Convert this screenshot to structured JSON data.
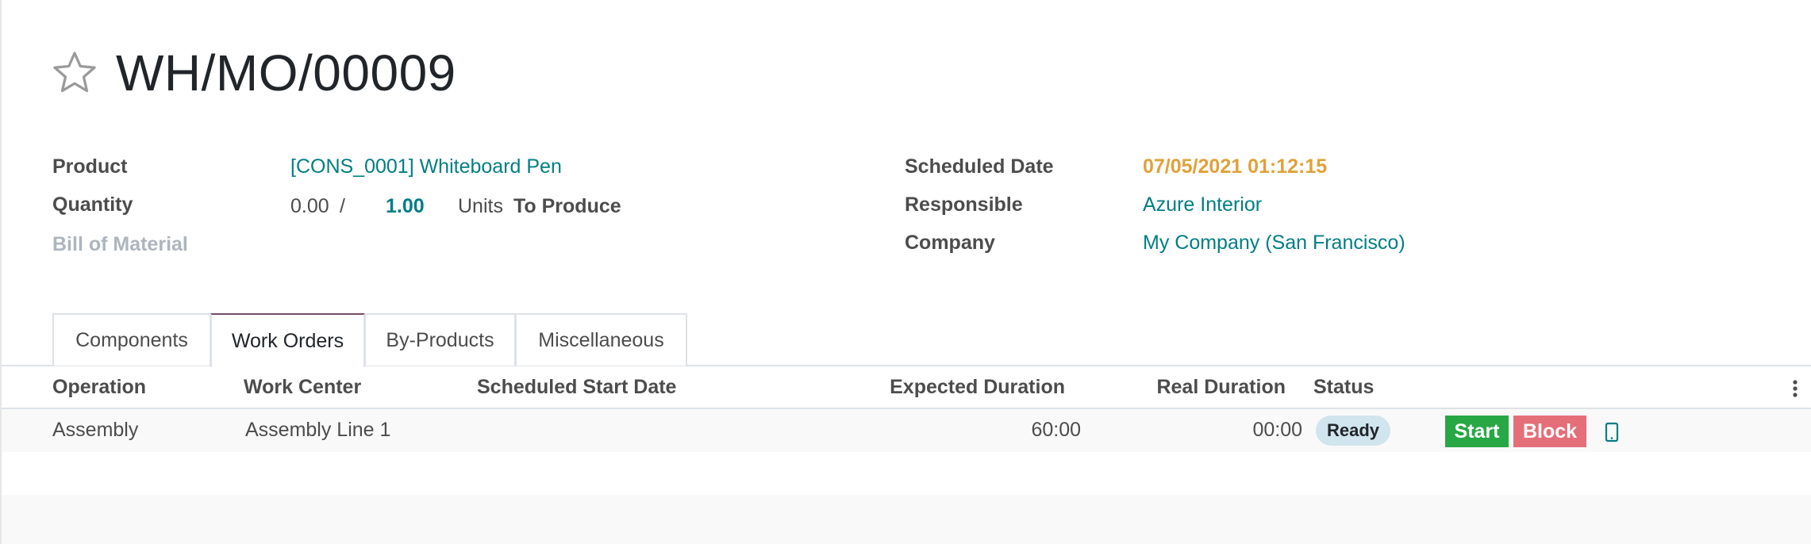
{
  "record": {
    "title": "WH/MO/00009"
  },
  "fields": {
    "product_label": "Product",
    "product_value": "[CONS_0001] Whiteboard Pen",
    "quantity_label": "Quantity",
    "quantity_produced": "0.00",
    "quantity_separator": "/",
    "quantity_to_produce": "1.00",
    "quantity_uom": "Units",
    "quantity_suffix": "To Produce",
    "bom_label": "Bill of Material",
    "scheduled_date_label": "Scheduled Date",
    "scheduled_date_value": "07/05/2021 01:12:15",
    "responsible_label": "Responsible",
    "responsible_value": "Azure Interior",
    "company_label": "Company",
    "company_value": "My Company (San Francisco)"
  },
  "tabs": [
    {
      "label": "Components"
    },
    {
      "label": "Work Orders"
    },
    {
      "label": "By-Products"
    },
    {
      "label": "Miscellaneous"
    }
  ],
  "table": {
    "headers": {
      "operation": "Operation",
      "work_center": "Work Center",
      "scheduled_start": "Scheduled Start Date",
      "expected_duration": "Expected Duration",
      "real_duration": "Real Duration",
      "status": "Status"
    },
    "rows": [
      {
        "operation": "Assembly",
        "work_center": "Assembly Line 1",
        "scheduled_start": "",
        "expected_duration": "60:00",
        "real_duration": "00:00",
        "status": "Ready",
        "start_label": "Start",
        "block_label": "Block"
      }
    ]
  },
  "icons": {
    "favorite": "star-outline-icon",
    "tablet": "tablet-icon",
    "options": "kebab-menu-icon"
  },
  "colors": {
    "link": "#017e84",
    "date_warning": "#e0a13b",
    "active_tab": "#714b67",
    "start_button": "#28a745",
    "block_button": "#e46f78",
    "status_badge": "#d0e5ed"
  }
}
